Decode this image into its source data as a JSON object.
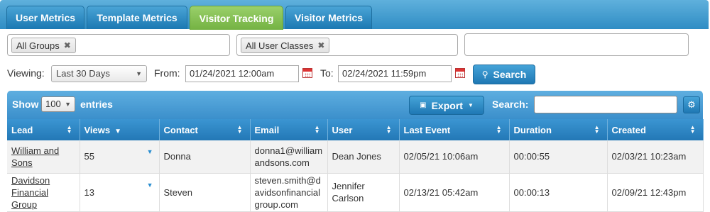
{
  "tabs": [
    {
      "label": "User Metrics",
      "active": false
    },
    {
      "label": "Template Metrics",
      "active": false
    },
    {
      "label": "Visitor Tracking",
      "active": true
    },
    {
      "label": "Visitor Metrics",
      "active": false
    }
  ],
  "filters": {
    "groups_chip": "All Groups",
    "user_classes_chip": "All User Classes",
    "remove_symbol": "✖",
    "third_input_value": ""
  },
  "date_range": {
    "viewing_label": "Viewing:",
    "viewing_value": "Last 30 Days",
    "from_label": "From:",
    "from_value": "01/24/2021 12:00am",
    "to_label": "To:",
    "to_value": "02/24/2021 11:59pm",
    "search_button": "Search"
  },
  "table_controls": {
    "show_label": "Show",
    "entries_value": "100",
    "entries_label": "entries",
    "export_label": "Export",
    "search_label": "Search:",
    "search_value": ""
  },
  "table": {
    "columns": [
      "Lead",
      "Views",
      "Contact",
      "Email",
      "User",
      "Last Event",
      "Duration",
      "Created"
    ],
    "rows": [
      {
        "lead": "William and Sons",
        "views": "55",
        "contact": "Donna",
        "email": "donna1@williamandsons.com",
        "user": "Dean Jones",
        "last_event": "02/05/21 10:06am",
        "duration": "00:00:55",
        "created": "02/03/21 10:23am"
      },
      {
        "lead": "Davidson Financial Group",
        "views": "13",
        "contact": "Steven",
        "email": "steven.smith@davidsonfinancialgroup.com",
        "user": "Jennifer Carlson",
        "last_event": "02/13/21 05:42am",
        "duration": "00:00:13",
        "created": "02/09/21 12:43pm"
      }
    ]
  },
  "colors": {
    "tab_active": "#7cb84a",
    "tab_inactive": "#2f8dc4",
    "header_blue": "#2378b6"
  }
}
